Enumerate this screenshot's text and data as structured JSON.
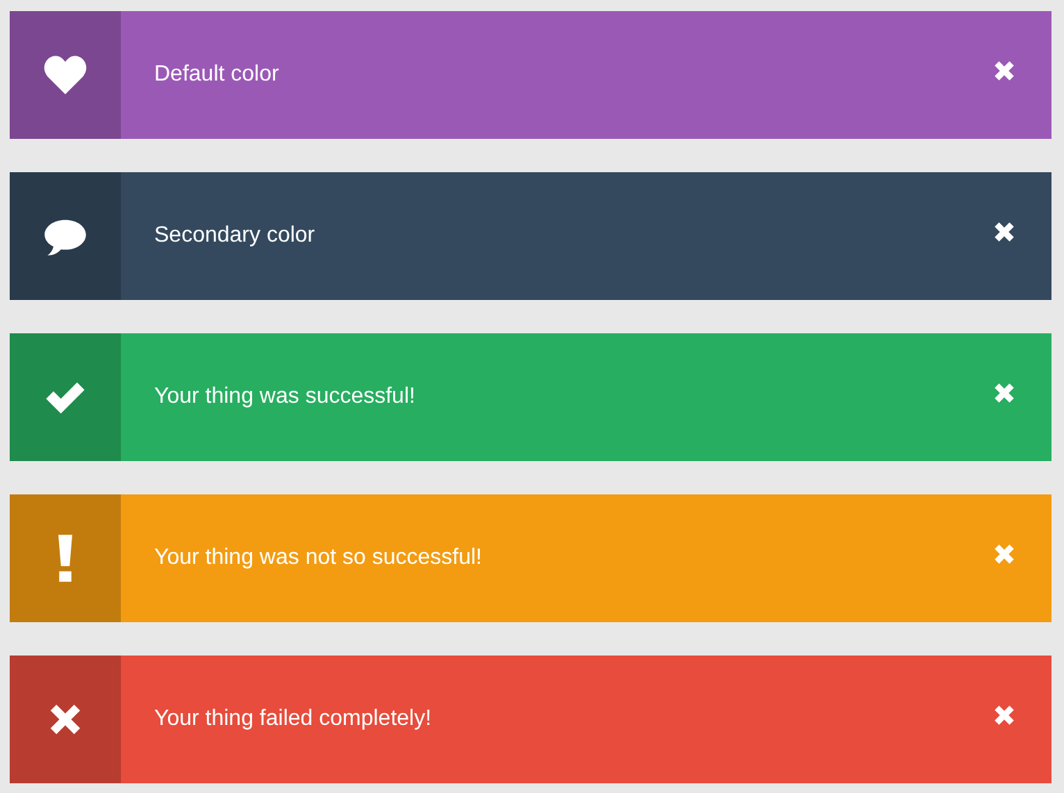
{
  "alerts": [
    {
      "kind": "heart",
      "text": "Default color",
      "color": "#9b59b6"
    },
    {
      "kind": "comment",
      "text": "Secondary color",
      "color": "#34495e"
    },
    {
      "kind": "check",
      "text": "Your thing was successful!",
      "color": "#27ae60"
    },
    {
      "kind": "exclamation",
      "text": "Your thing was not so successful!",
      "color": "#f39c12"
    },
    {
      "kind": "cross",
      "text": "Your thing failed completely!",
      "color": "#e74c3c"
    }
  ]
}
